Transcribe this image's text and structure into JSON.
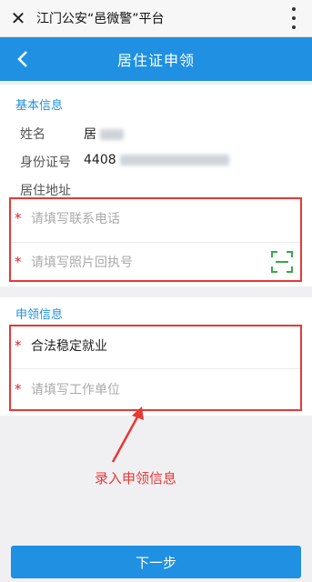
{
  "window": {
    "title": "江门公安“邑微警”平台"
  },
  "header": {
    "title": "居住证申领"
  },
  "basic": {
    "section_title": "基本信息",
    "name_label": "姓名",
    "name_value": "居",
    "id_label": "身份证号",
    "id_value": "4408",
    "address_label": "居住地址",
    "phone_placeholder": "请填写联系电话",
    "receipt_placeholder": "请填写照片回执号"
  },
  "apply": {
    "section_title": "申领信息",
    "reason_value": "合法稳定就业",
    "employer_placeholder": "请填写工作单位"
  },
  "annotation": {
    "text": "录入申领信息"
  },
  "footer": {
    "next_label": "下一步"
  },
  "colors": {
    "brand": "#1f90e2",
    "required": "#d22222",
    "annotation": "#e53935"
  }
}
